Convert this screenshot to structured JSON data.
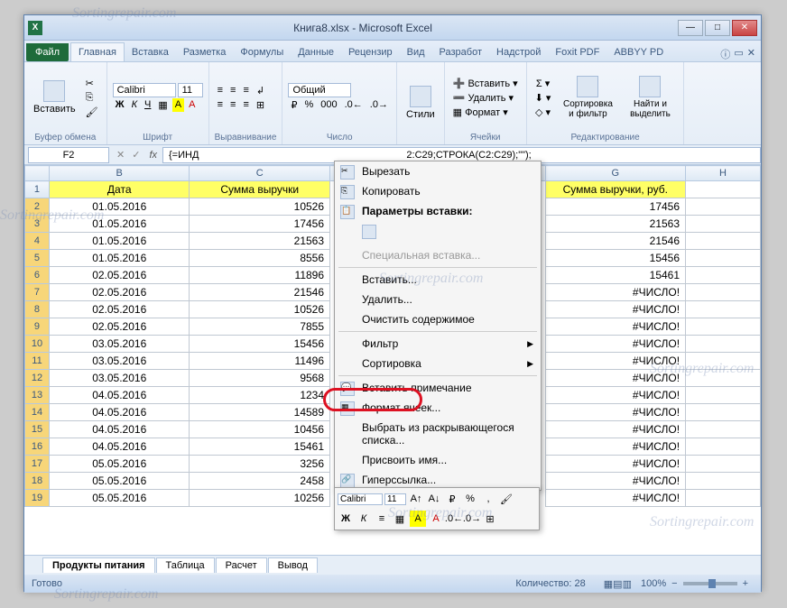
{
  "window": {
    "title": "Книга8.xlsx - Microsoft Excel"
  },
  "tabs": {
    "file": "Файл",
    "items": [
      "Главная",
      "Вставка",
      "Разметка",
      "Формулы",
      "Данные",
      "Рецензир",
      "Вид",
      "Разработ",
      "Надстрой",
      "Foxit PDF",
      "ABBYY PD"
    ],
    "active": 0
  },
  "ribbon": {
    "clipboard": {
      "paste": "Вставить",
      "label": "Буфер обмена"
    },
    "font": {
      "name": "Calibri",
      "size": "11",
      "label": "Шрифт"
    },
    "align": {
      "label": "Выравнивание"
    },
    "number": {
      "format": "Общий",
      "label": "Число"
    },
    "styles": {
      "btn": "Стили"
    },
    "cells": {
      "insert": "Вставить",
      "delete": "Удалить",
      "format": "Формат",
      "label": "Ячейки"
    },
    "editing": {
      "sort": "Сортировка и фильтр",
      "find": "Найти и выделить",
      "label": "Редактирование"
    }
  },
  "formula": {
    "cell": "F2",
    "text": "{=ИНД",
    "text2": "2:C29;СТРОКА(C2:C29);\"\");"
  },
  "headers": {
    "rowcol": "",
    "cols": [
      "B",
      "C",
      "G",
      "H"
    ]
  },
  "table": {
    "col_b": "Дата",
    "col_c": "Сумма выручки",
    "col_g": "Сумма выручки, руб.",
    "rows": [
      {
        "n": "1"
      },
      {
        "n": "2",
        "b": "01.05.2016",
        "c": "10526",
        "g": "17456"
      },
      {
        "n": "3",
        "b": "01.05.2016",
        "c": "17456",
        "g": "21563"
      },
      {
        "n": "4",
        "b": "01.05.2016",
        "c": "21563",
        "g": "21546"
      },
      {
        "n": "5",
        "b": "01.05.2016",
        "c": "8556",
        "g": "15456"
      },
      {
        "n": "6",
        "b": "02.05.2016",
        "c": "11896",
        "g": "15461"
      },
      {
        "n": "7",
        "b": "02.05.2016",
        "c": "21546",
        "g": "#ЧИСЛО!"
      },
      {
        "n": "8",
        "b": "02.05.2016",
        "c": "10526",
        "g": "#ЧИСЛО!"
      },
      {
        "n": "9",
        "b": "02.05.2016",
        "c": "7855",
        "g": "#ЧИСЛО!"
      },
      {
        "n": "10",
        "b": "03.05.2016",
        "c": "15456",
        "g": "#ЧИСЛО!"
      },
      {
        "n": "11",
        "b": "03.05.2016",
        "c": "11496",
        "g": "#ЧИСЛО!"
      },
      {
        "n": "12",
        "b": "03.05.2016",
        "c": "9568",
        "g": "#ЧИСЛО!"
      },
      {
        "n": "13",
        "b": "04.05.2016",
        "c": "1234",
        "g": "#ЧИСЛО!"
      },
      {
        "n": "14",
        "b": "04.05.2016",
        "c": "14589",
        "g": "#ЧИСЛО!"
      },
      {
        "n": "15",
        "b": "04.05.2016",
        "c": "10456",
        "g": "#ЧИСЛО!"
      },
      {
        "n": "16",
        "b": "04.05.2016",
        "c": "15461",
        "g": "#ЧИСЛО!"
      },
      {
        "n": "17",
        "b": "05.05.2016",
        "c": "3256",
        "g": "#ЧИСЛО!"
      },
      {
        "n": "18",
        "b": "05.05.2016",
        "c": "2458",
        "g": "#ЧИСЛО!"
      },
      {
        "n": "19",
        "b": "05.05.2016",
        "c": "10256",
        "g": "#ЧИСЛО!"
      }
    ]
  },
  "context": {
    "cut": "Вырезать",
    "copy": "Копировать",
    "paste_opts": "Параметры вставки:",
    "paste_special": "Специальная вставка...",
    "insert": "Вставить...",
    "delete": "Удалить...",
    "clear": "Очистить содержимое",
    "filter": "Фильтр",
    "sort": "Сортировка",
    "comment": "Вставить примечание",
    "format_cells": "Формат ячеек...",
    "dropdown": "Выбрать из раскрывающегося списка...",
    "name": "Присвоить имя...",
    "hyperlink": "Гиперссылка..."
  },
  "mini": {
    "font": "Calibri",
    "size": "11"
  },
  "sheets": {
    "items": [
      "Продукты питания",
      "Таблица",
      "Расчет",
      "Вывод"
    ],
    "active": 0
  },
  "status": {
    "ready": "Готово",
    "count_label": "Количество:",
    "count": "28",
    "zoom": "100%"
  }
}
